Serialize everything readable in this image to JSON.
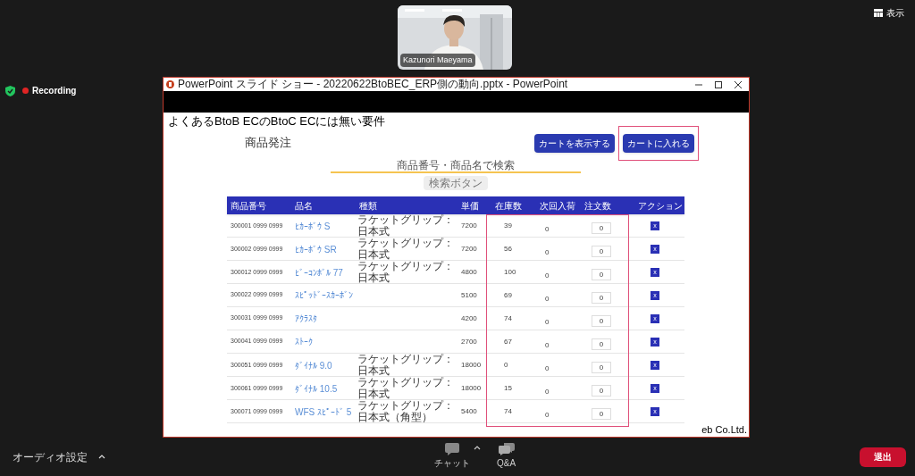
{
  "meeting": {
    "participant": {
      "name": "Kazunori Maeyama"
    },
    "view_button": "表示",
    "recording_label": "Recording"
  },
  "shared_window": {
    "title": "PowerPoint スライド ショー - 20220622BtoBEC_ERP側の動向.pptx - PowerPoint",
    "slide": {
      "title": "よくあるBtoB ECのBtoC ECには無い要件",
      "page_title": "商品発注",
      "buttons": [
        {
          "label": "カートを表示する",
          "highlighted": false
        },
        {
          "label": "カートに入れる",
          "highlighted": true
        }
      ],
      "search": {
        "placeholder": "商品番号・商品名で検索",
        "button": "検索ボタン",
        "button_disabled": true
      },
      "table": {
        "columns": [
          {
            "label": "商品番号"
          },
          {
            "label": "品名"
          },
          {
            "label": "種類"
          },
          {
            "label": "単価"
          },
          {
            "label": "在庫数"
          },
          {
            "label": "次回入荷"
          },
          {
            "label": "注文数"
          },
          {
            "label": "アクション"
          }
        ],
        "stock_columns_highlighted": true,
        "rows": [
          {
            "code": "300001 0999 0999",
            "name": "ﾋｶｰﾎﾞｳ S",
            "type": "ラケットグリップ：日本式",
            "price": "7200",
            "stock": "39",
            "next": "0",
            "qty": "0",
            "action": "x"
          },
          {
            "code": "300002 0999 0999",
            "name": "ﾋｶｰﾎﾞｳ SR",
            "type": "ラケットグリップ：日本式",
            "price": "7200",
            "stock": "56",
            "next": "0",
            "qty": "0",
            "action": "x"
          },
          {
            "code": "300012 0999 0999",
            "name": "ﾋﾞｰｺﾝﾎﾞﾙ 77",
            "type": "ラケットグリップ：日本式",
            "price": "4800",
            "stock": "100",
            "next": "0",
            "qty": "0",
            "action": "x"
          },
          {
            "code": "300022 0999 0999",
            "name": "ｽﾋﾟｯﾄﾞｰｽｶｰﾎﾞﾝ",
            "price": "5100",
            "stock": "69",
            "next": "0",
            "qty": "0",
            "action": "x"
          },
          {
            "code": "300031 0999 0999",
            "name": "ｱｸﾗｽﾀ",
            "price": "4200",
            "stock": "74",
            "next": "0",
            "qty": "0",
            "action": "x"
          },
          {
            "code": "300041 0999 0999",
            "name": "ｽﾄｰｸ",
            "price": "2700",
            "stock": "67",
            "next": "0",
            "qty": "0",
            "action": "x"
          },
          {
            "code": "300051 0999 0999",
            "name": "ﾀﾞｲﾅﾙ 9.0",
            "type": "ラケットグリップ：日本式",
            "price": "18000",
            "stock": "0",
            "next": "0",
            "qty": "0",
            "action": "x"
          },
          {
            "code": "300061 0999 0999",
            "name": "ﾀﾞｲﾅﾙ 10.5",
            "type": "ラケットグリップ：日本式",
            "price": "18000",
            "stock": "15",
            "next": "0",
            "qty": "0",
            "action": "x"
          },
          {
            "code": "300071 0999 0999",
            "name": "WFS ｽﾋﾟｰﾄﾞ 5",
            "type": "ラケットグリップ：日本式（角型）",
            "price": "5400",
            "stock": "74",
            "next": "0",
            "qty": "0",
            "action": "x"
          }
        ]
      },
      "footer": "eb Co.Ltd."
    }
  },
  "toolbar": {
    "audio_label": "オーディオ設定",
    "items": [
      {
        "label": "チャット",
        "kind": "chat"
      },
      {
        "label": "Q&A",
        "kind": "qa"
      }
    ],
    "leave_button": "退出"
  }
}
